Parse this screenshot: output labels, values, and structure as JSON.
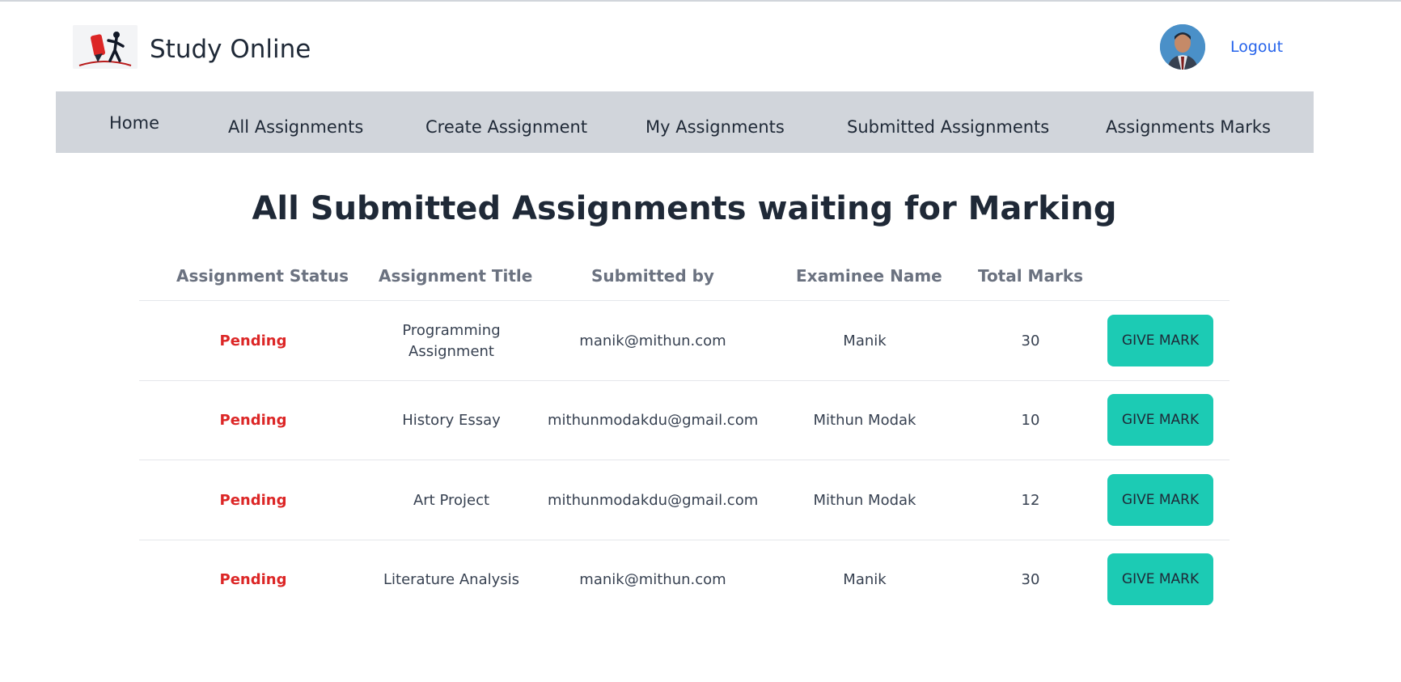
{
  "app": {
    "title": "Study Online"
  },
  "header": {
    "logout_label": "Logout"
  },
  "nav": {
    "items": [
      {
        "label": "Home"
      },
      {
        "label": "All Assignments"
      },
      {
        "label": "Create Assignment"
      },
      {
        "label": "My Assignments"
      },
      {
        "label": "Submitted Assignments"
      },
      {
        "label": "Assignments Marks"
      }
    ]
  },
  "main": {
    "title": "All Submitted Assignments waiting for Marking",
    "columns": [
      "Assignment Status",
      "Assignment Title",
      "Submitted by",
      "Examinee Name",
      "Total Marks"
    ],
    "rows": [
      {
        "status": "Pending",
        "title": "Programming Assignment",
        "submitted_by": "manik@mithun.com",
        "examinee": "Manik",
        "marks": "30",
        "action": "GIVE MARK"
      },
      {
        "status": "Pending",
        "title": "History Essay",
        "submitted_by": "mithunmodakdu@gmail.com",
        "examinee": "Mithun Modak",
        "marks": "10",
        "action": "GIVE MARK"
      },
      {
        "status": "Pending",
        "title": "Art Project",
        "submitted_by": "mithunmodakdu@gmail.com",
        "examinee": "Mithun Modak",
        "marks": "12",
        "action": "GIVE MARK"
      },
      {
        "status": "Pending",
        "title": "Literature Analysis",
        "submitted_by": "manik@mithun.com",
        "examinee": "Manik",
        "marks": "30",
        "action": "GIVE MARK"
      }
    ]
  },
  "colors": {
    "nav_bg": "#d1d5db",
    "status_pending": "#dc2626",
    "action_button": "#1ccbb4",
    "link": "#2563eb"
  },
  "icons": {
    "logo": "study-online-logo",
    "avatar": "user-avatar"
  }
}
